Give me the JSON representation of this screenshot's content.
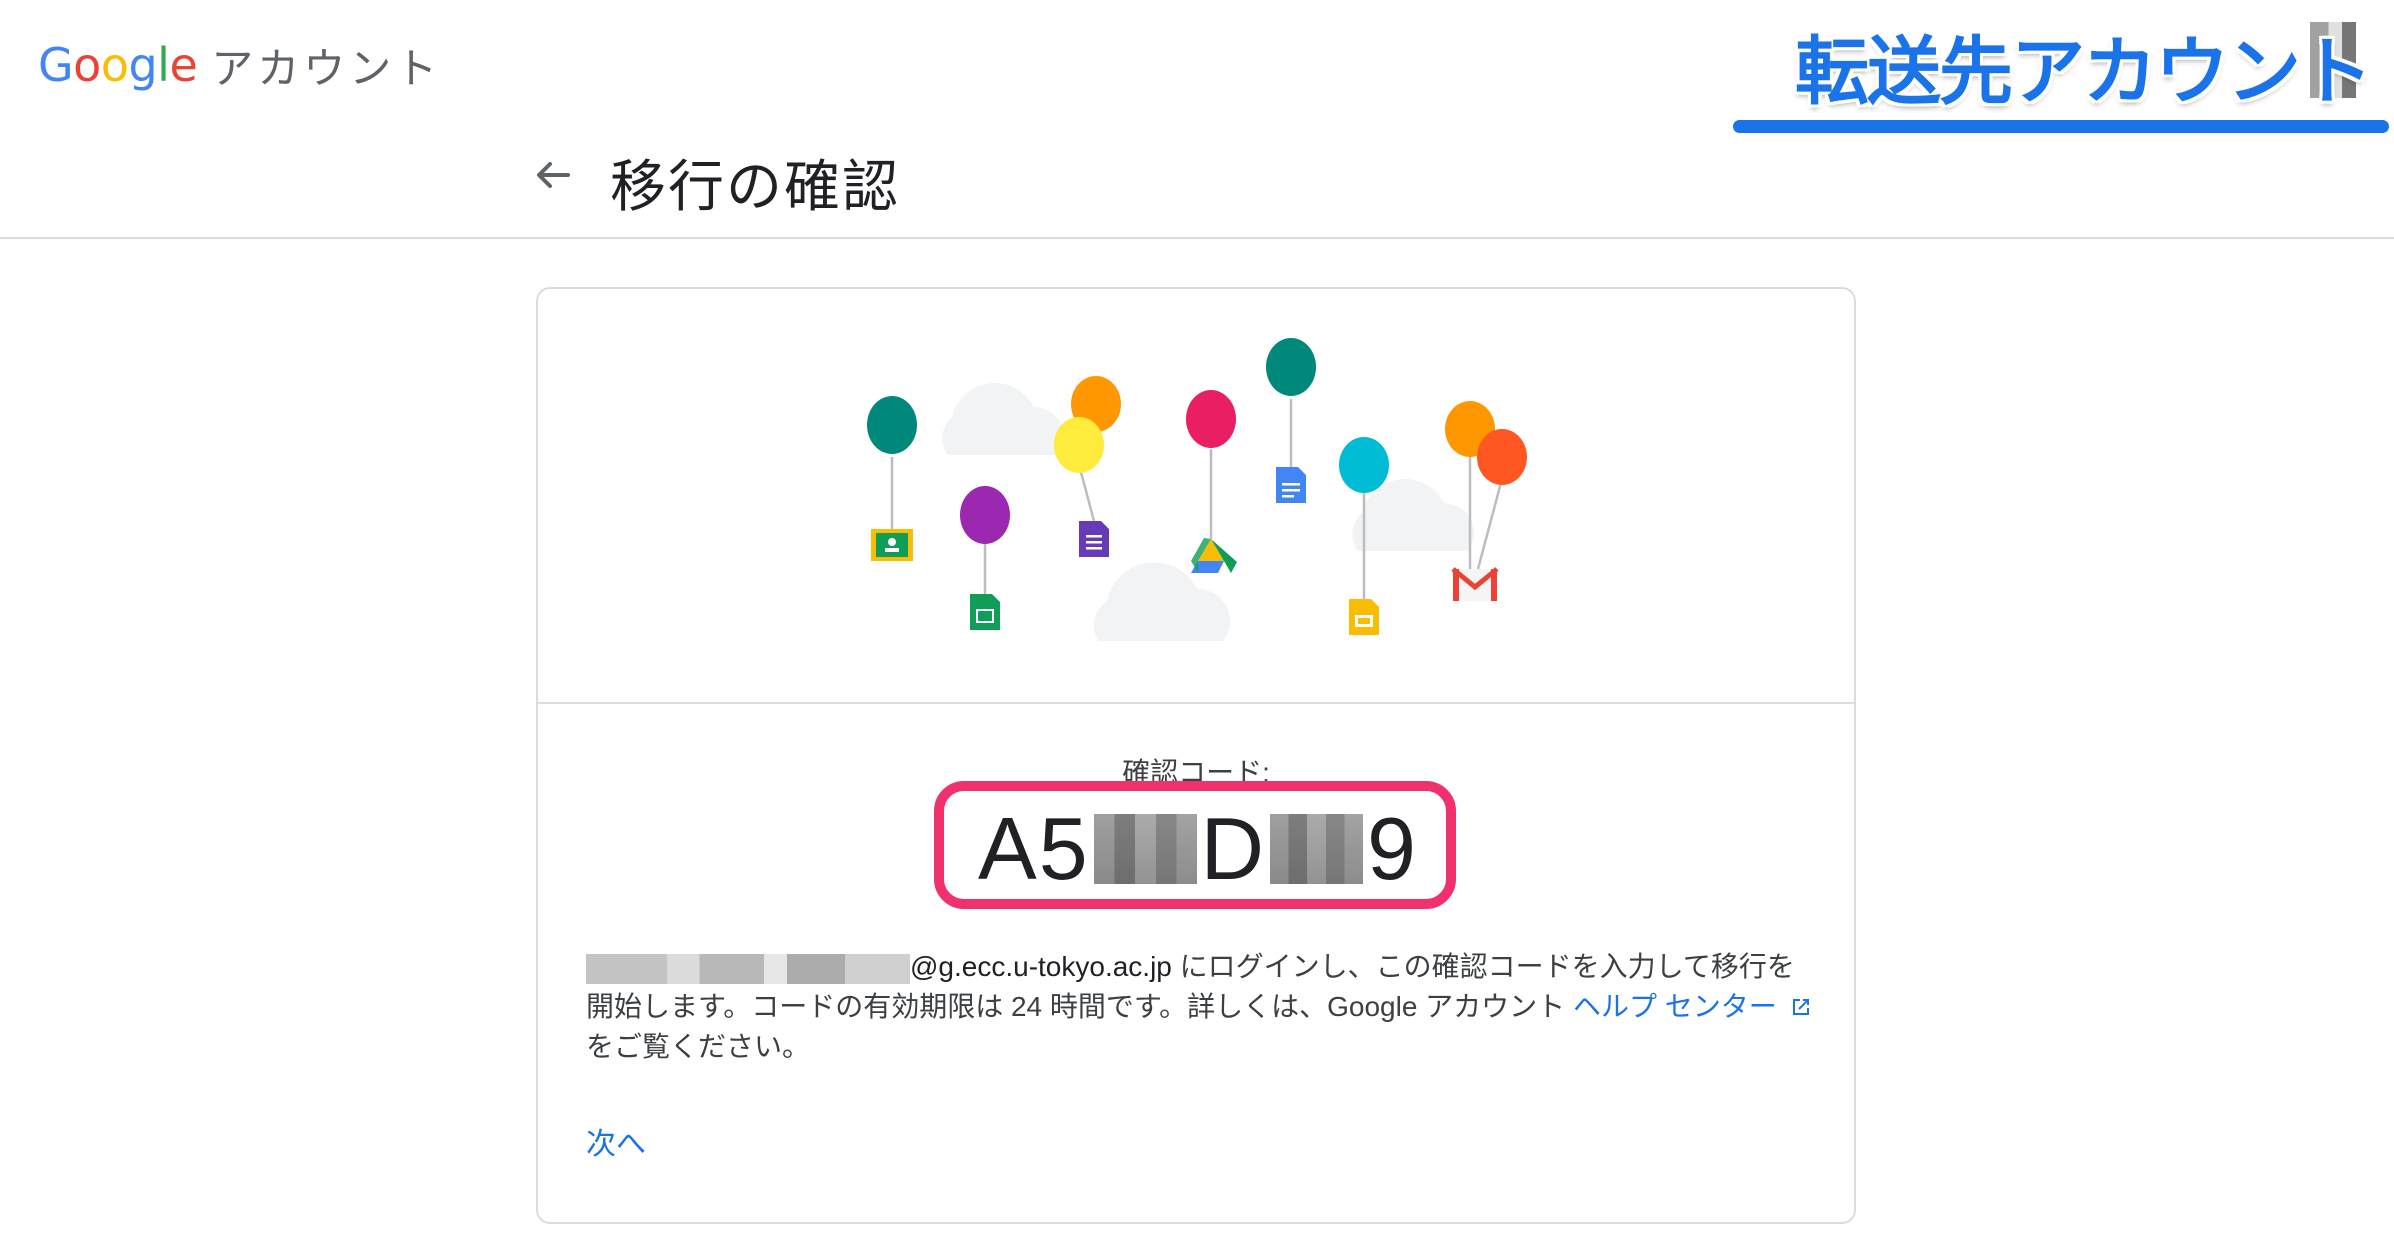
{
  "header": {
    "logo_word": "Google",
    "logo_product": "アカウント",
    "badge_text": "転送先アカウント",
    "page_title": "移行の確認",
    "back_icon": "arrow-back-icon"
  },
  "card": {
    "code_label": "確認コード:",
    "code_parts": [
      "A5",
      "D",
      "9"
    ],
    "description": {
      "email_domain": "@g.ecc.u-tokyo.ac.jp",
      "text1": " にログインし、この確認コードを入力して移行を開始します。コードの有効期限は 24 時間です。詳しくは、Google アカウント ",
      "help_link": "ヘルプ センター",
      "text2": "をご覧ください。"
    },
    "next_label": "次へ"
  },
  "colors": {
    "accent": "#1a73e8",
    "highlight": "#f0316d",
    "divider": "#dadce0"
  },
  "illustration_icons": [
    "classroom-icon",
    "sheets-icon",
    "forms-icon",
    "drive-icon",
    "docs-icon",
    "slides-icon",
    "gmail-icon",
    "balloon-icon",
    "cloud-icon"
  ]
}
